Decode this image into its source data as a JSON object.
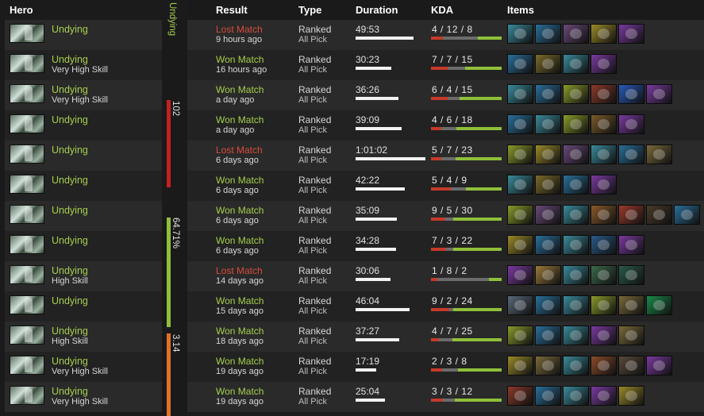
{
  "left": {
    "header": "Hero",
    "rows": [
      {
        "hero": "Undying",
        "skill": ""
      },
      {
        "hero": "Undying",
        "skill": "Very High Skill"
      },
      {
        "hero": "Undying",
        "skill": "Very High Skill"
      },
      {
        "hero": "Undying",
        "skill": ""
      },
      {
        "hero": "Undying",
        "skill": ""
      },
      {
        "hero": "Undying",
        "skill": ""
      },
      {
        "hero": "Undying",
        "skill": ""
      },
      {
        "hero": "Undying",
        "skill": ""
      },
      {
        "hero": "Undying",
        "skill": "High Skill"
      },
      {
        "hero": "Undying",
        "skill": ""
      },
      {
        "hero": "Undying",
        "skill": "High Skill"
      },
      {
        "hero": "Undying",
        "skill": "Very High Skill"
      },
      {
        "hero": "Undying",
        "skill": "Very High Skill"
      }
    ]
  },
  "stats": {
    "hero_label": "Undying",
    "matches": "102",
    "winrate": "64.71%",
    "kda_ratio": "3.14",
    "colors": {
      "hero": "#a6cf4b",
      "matches": "#c62020",
      "winrate": "#8fbf3a",
      "kda": "#e0702a"
    }
  },
  "table": {
    "headers": {
      "result": "Result",
      "type": "Type",
      "duration": "Duration",
      "kda": "KDA",
      "items": "Items"
    },
    "rows": [
      {
        "result": "Lost Match",
        "outcome": "lost",
        "ago": "9 hours ago",
        "type": "Ranked",
        "mode": "All Pick",
        "duration": "49:53",
        "dur_frac": 0.83,
        "k": 4,
        "d": 12,
        "a": 8,
        "kda": "4 / 12 / 8",
        "items": [
          "#3a8a9a",
          "#2a6f9a",
          "#6a4a7a",
          "#9a8a2a",
          "#7a3aa0"
        ]
      },
      {
        "result": "Won Match",
        "outcome": "won",
        "ago": "16 hours ago",
        "type": "Ranked",
        "mode": "All Pick",
        "duration": "30:23",
        "dur_frac": 0.51,
        "k": 7,
        "d": 7,
        "a": 15,
        "kda": "7 / 7 / 15",
        "items": [
          "#2a6f9a",
          "#7a6a2a",
          "#3a8a9a",
          "#7a3aa0"
        ]
      },
      {
        "result": "Won Match",
        "outcome": "won",
        "ago": "a day ago",
        "type": "Ranked",
        "mode": "All Pick",
        "duration": "36:26",
        "dur_frac": 0.61,
        "k": 6,
        "d": 4,
        "a": 15,
        "kda": "6 / 4 / 15",
        "items": [
          "#3a8a9a",
          "#2a6f9a",
          "#8a9a2a",
          "#8a3a2a",
          "#2a5aba",
          "#7a3aa0"
        ]
      },
      {
        "result": "Won Match",
        "outcome": "won",
        "ago": "a day ago",
        "type": "Ranked",
        "mode": "All Pick",
        "duration": "39:09",
        "dur_frac": 0.66,
        "k": 4,
        "d": 6,
        "a": 18,
        "kda": "4 / 6 / 18",
        "items": [
          "#2a6f9a",
          "#3a8a9a",
          "#8a9a2a",
          "#7a5a2a",
          "#7a3aa0"
        ]
      },
      {
        "result": "Lost Match",
        "outcome": "lost",
        "ago": "6 days ago",
        "type": "Ranked",
        "mode": "All Pick",
        "duration": "1:01:02",
        "dur_frac": 1.0,
        "k": 5,
        "d": 7,
        "a": 23,
        "kda": "5 / 7 / 23",
        "items": [
          "#8a9a2a",
          "#9a8a2a",
          "#6a4a7a",
          "#3a8a9a",
          "#2a6f9a",
          "#7a6a3a"
        ]
      },
      {
        "result": "Won Match",
        "outcome": "won",
        "ago": "6 days ago",
        "type": "Ranked",
        "mode": "All Pick",
        "duration": "42:22",
        "dur_frac": 0.71,
        "k": 5,
        "d": 4,
        "a": 9,
        "kda": "5 / 4 / 9",
        "items": [
          "#3a8a9a",
          "#7a6a2a",
          "#2a6f9a",
          "#7a3aa0"
        ]
      },
      {
        "result": "Won Match",
        "outcome": "won",
        "ago": "6 days ago",
        "type": "Ranked",
        "mode": "All Pick",
        "duration": "35:09",
        "dur_frac": 0.59,
        "k": 9,
        "d": 5,
        "a": 30,
        "kda": "9 / 5 / 30",
        "items": [
          "#8a9a2a",
          "#6a4a7a",
          "#3a8a9a",
          "#8a5a2a",
          "#9a3a2a",
          "#4a3a2a",
          "#2a6f9a"
        ]
      },
      {
        "result": "Won Match",
        "outcome": "won",
        "ago": "6 days ago",
        "type": "Ranked",
        "mode": "All Pick",
        "duration": "34:28",
        "dur_frac": 0.58,
        "k": 7,
        "d": 3,
        "a": 22,
        "kda": "7 / 3 / 22",
        "items": [
          "#9a8a2a",
          "#2a6f9a",
          "#3a8a9a",
          "#2a5a8a",
          "#7a3aa0"
        ]
      },
      {
        "result": "Lost Match",
        "outcome": "lost",
        "ago": "14 days ago",
        "type": "Ranked",
        "mode": "All Pick",
        "duration": "30:06",
        "dur_frac": 0.5,
        "k": 1,
        "d": 8,
        "a": 2,
        "kda": "1 / 8 / 2",
        "items": [
          "#7a3aa0",
          "#9a7a3a",
          "#3a8a9a",
          "#3a6a4a",
          "#2a5a4a"
        ]
      },
      {
        "result": "Won Match",
        "outcome": "won",
        "ago": "15 days ago",
        "type": "Ranked",
        "mode": "All Pick",
        "duration": "46:04",
        "dur_frac": 0.77,
        "k": 9,
        "d": 2,
        "a": 24,
        "kda": "9 / 2 / 24",
        "items": [
          "#5a6a7a",
          "#2a6f9a",
          "#3a8a9a",
          "#8a9a2a",
          "#7a6a3a",
          "#1a8a4a"
        ]
      },
      {
        "result": "Won Match",
        "outcome": "won",
        "ago": "18 days ago",
        "type": "Ranked",
        "mode": "All Pick",
        "duration": "37:27",
        "dur_frac": 0.63,
        "k": 4,
        "d": 7,
        "a": 25,
        "kda": "4 / 7 / 25",
        "items": [
          "#8a9a2a",
          "#2a6f9a",
          "#3a8a9a",
          "#7a3aa0",
          "#7a6a3a"
        ]
      },
      {
        "result": "Won Match",
        "outcome": "won",
        "ago": "19 days ago",
        "type": "Ranked",
        "mode": "All Pick",
        "duration": "17:19",
        "dur_frac": 0.29,
        "k": 2,
        "d": 3,
        "a": 8,
        "kda": "2 / 3 / 8",
        "items": [
          "#9a8a2a",
          "#7a6a3a",
          "#3a8a9a",
          "#8a4a2a",
          "#5a4a3a",
          "#7a3aa0"
        ]
      },
      {
        "result": "Won Match",
        "outcome": "won",
        "ago": "19 days ago",
        "type": "Ranked",
        "mode": "All Pick",
        "duration": "25:04",
        "dur_frac": 0.42,
        "k": 3,
        "d": 3,
        "a": 12,
        "kda": "3 / 3 / 12",
        "items": [
          "#8a3a2a",
          "#2a6f9a",
          "#3a8a9a",
          "#7a3aa0",
          "#9a8a2a"
        ]
      }
    ]
  }
}
